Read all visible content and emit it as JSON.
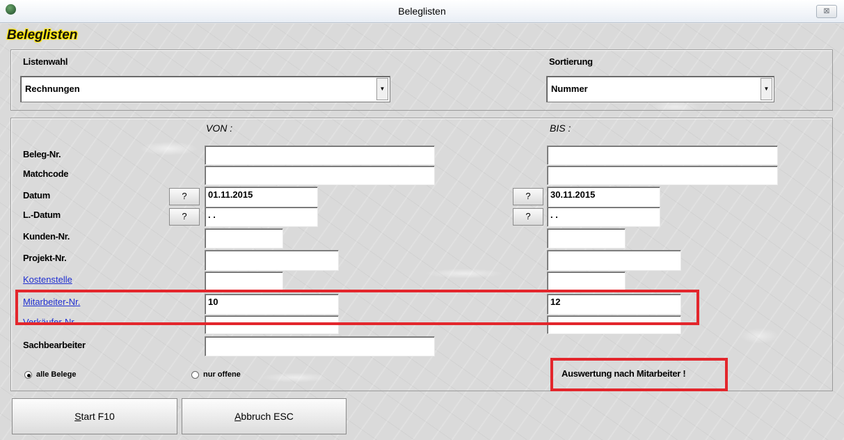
{
  "window": {
    "title": "Beleglisten",
    "close_glyph": "⊠",
    "app_icon": "app-logo-icon"
  },
  "heading": "Beleglisten",
  "top_group": {
    "listenwahl_label": "Listenwahl",
    "listenwahl_value": "Rechnungen",
    "sortierung_label": "Sortierung",
    "sortierung_value": "Nummer",
    "dropdown_glyph": "▼"
  },
  "filter": {
    "von_label": "VON :",
    "bis_label": "BIS :",
    "rows": {
      "beleg_nr": {
        "label": "Beleg-Nr.",
        "von": "",
        "bis": ""
      },
      "matchcode": {
        "label": "Matchcode",
        "von": "",
        "bis": ""
      },
      "datum": {
        "label": "Datum",
        "von": "01.11.2015",
        "bis": "30.11.2015"
      },
      "l_datum": {
        "label": "L.-Datum",
        "von": " . .",
        "bis": " . ."
      },
      "kunden_nr": {
        "label": "Kunden-Nr.",
        "von": "",
        "bis": ""
      },
      "projekt_nr": {
        "label": "Projekt-Nr.",
        "von": "",
        "bis": ""
      },
      "kostenstelle": {
        "label": "Kostenstelle",
        "von": "",
        "bis": ""
      },
      "mitarbeiter_nr": {
        "label": "Mitarbeiter-Nr.",
        "von": "10",
        "bis": "12"
      },
      "verkaeufer_nr": {
        "label": "Verkäufer-Nr.",
        "von": "",
        "bis": ""
      },
      "sachbearbeiter": {
        "label": "Sachbearbeiter",
        "von": ""
      }
    },
    "question_btn": "?",
    "radio_all": "alle Belege",
    "radio_open": "nur offene",
    "note": "Auswertung nach Mitarbeiter !"
  },
  "buttons": {
    "start_hotkey": "S",
    "start_rest": "tart F10",
    "abbruch_hotkey": "A",
    "abbruch_rest": "bbruch ESC"
  },
  "colors": {
    "highlight": "#e3262c",
    "link": "#1f2fd0",
    "heading_glow": "#ffe600"
  }
}
